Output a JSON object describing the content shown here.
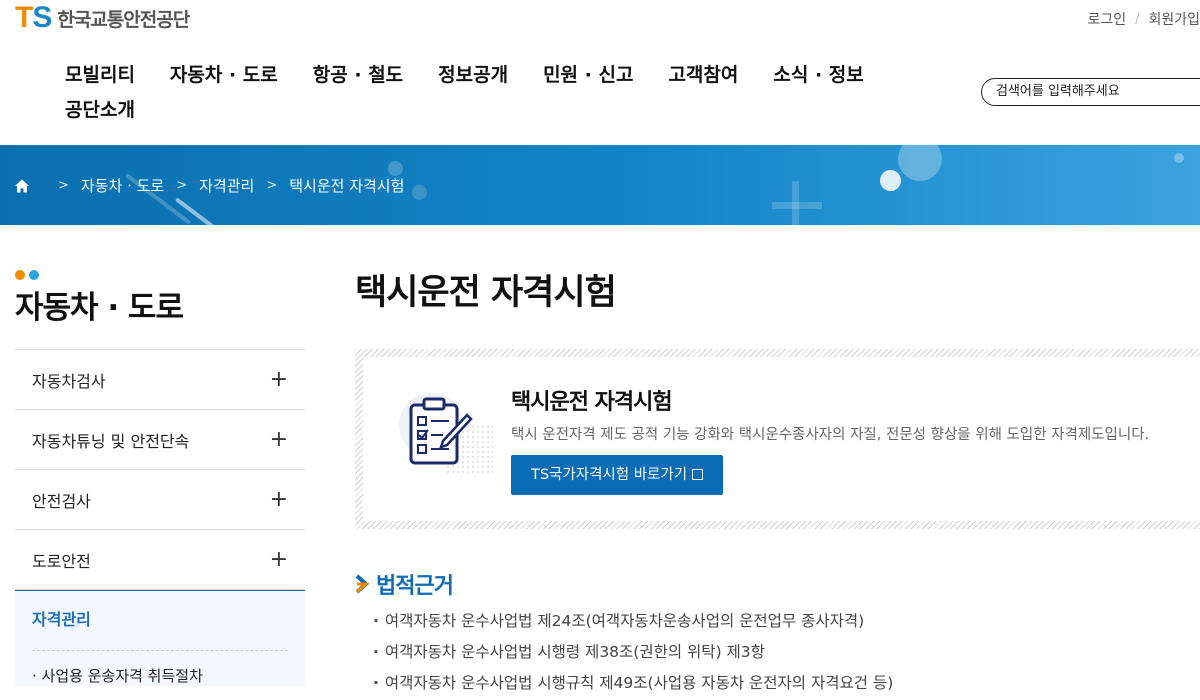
{
  "header": {
    "logo_mark": "TS",
    "logo_text": "한국교통안전공단",
    "util_links": [
      "로그인",
      "회원가입"
    ],
    "gnb": [
      "모빌리티",
      "자동차 · 도로",
      "항공 · 철도",
      "정보공개",
      "민원 · 신고",
      "고객참여",
      "소식 · 정보",
      "공단소개"
    ],
    "search_placeholder": "검색어를 입력해주세요"
  },
  "breadcrumb": [
    "자동차 · 도로",
    "자격관리",
    "택시운전 자격시험"
  ],
  "sidebar": {
    "title": "자동차 · 도로",
    "items": [
      {
        "label": "자동차검사"
      },
      {
        "label": "자동차튜닝 및 안전단속"
      },
      {
        "label": "안전검사"
      },
      {
        "label": "도로안전"
      }
    ],
    "active": {
      "label": "자격관리",
      "sub": "사업용 운송자격 취득절차"
    }
  },
  "main": {
    "title": "택시운전 자격시험",
    "intro": {
      "title": "택시운전 자격시험",
      "desc": "택시 운전자격 제도 공적 기능 강화와 택시운수종사자의 자질, 전문성 향상을 위해 도입한 자격제도입니다.",
      "button": "TS국가자격시험 바로가기"
    },
    "law": {
      "title": "법적근거",
      "items": [
        "여객자동차 운수사업법 제24조(여객자동차운송사업의 운전업무 종사자격)",
        "여객자동차 운수사업법 시행령 제38조(권한의 위탁) 제3항",
        "여객자동차 운수사업법 시행규칙 제49조(사업용 자동차 운전자의 자격요건 등)"
      ]
    }
  },
  "colors": {
    "brand_orange": "#f08c00",
    "brand_blue": "#1a86c8",
    "accent_blue": "#0a6cb5"
  },
  "icons": [
    "home-icon",
    "chevron-right-icon",
    "plus-icon",
    "checklist-icon",
    "external-link-icon",
    "arrow-right-icon"
  ]
}
